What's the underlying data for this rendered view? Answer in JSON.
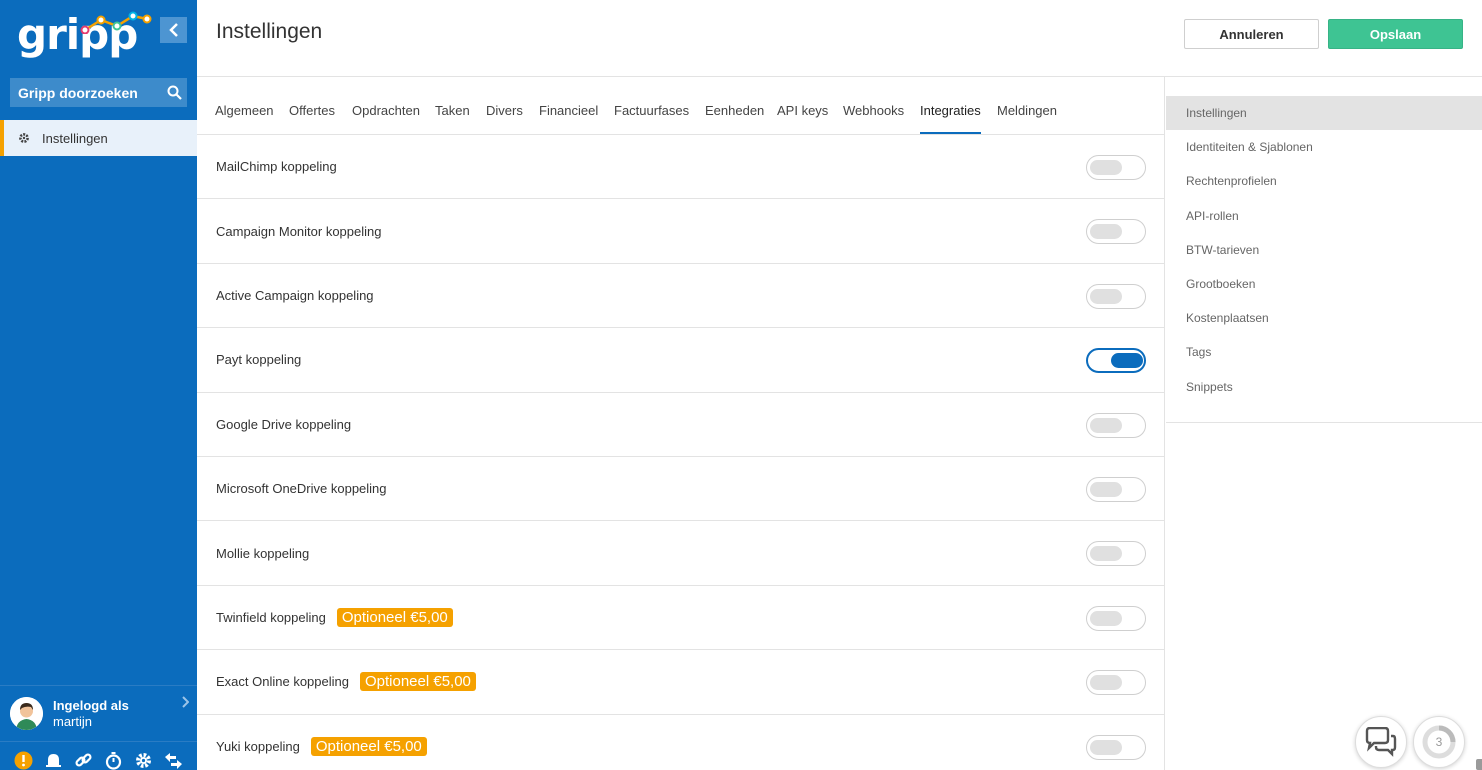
{
  "sidebar": {
    "logo": "gripp",
    "search_label": "Gripp doorzoeken",
    "nav_item": "Instellingen",
    "user_title": "Ingelogd als",
    "user_name": "martijn"
  },
  "header": {
    "title": "Instellingen",
    "cancel_label": "Annuleren",
    "save_label": "Opslaan"
  },
  "tabs": [
    "Algemeen",
    "Offertes",
    "Opdrachten",
    "Taken",
    "Divers",
    "Financieel",
    "Factuurfases",
    "Eenheden",
    "API keys",
    "Webhooks",
    "Integraties",
    "Meldingen"
  ],
  "active_tab": "Integraties",
  "integrations": [
    {
      "label": "MailChimp koppeling",
      "badge": "",
      "enabled": false
    },
    {
      "label": "Campaign Monitor koppeling",
      "badge": "",
      "enabled": false
    },
    {
      "label": "Active Campaign koppeling",
      "badge": "",
      "enabled": false
    },
    {
      "label": "Payt koppeling",
      "badge": "",
      "enabled": true
    },
    {
      "label": "Google Drive koppeling",
      "badge": "",
      "enabled": false
    },
    {
      "label": "Microsoft OneDrive koppeling",
      "badge": "",
      "enabled": false
    },
    {
      "label": "Mollie koppeling",
      "badge": "",
      "enabled": false
    },
    {
      "label": "Twinfield koppeling",
      "badge": "Optioneel €5,00",
      "enabled": false
    },
    {
      "label": "Exact Online koppeling",
      "badge": "Optioneel €5,00",
      "enabled": false
    },
    {
      "label": "Yuki koppeling",
      "badge": "Optioneel €5,00",
      "enabled": false
    }
  ],
  "right_panel": {
    "items": [
      "Instellingen",
      "Identiteiten & Sjablonen",
      "Rechtenprofielen",
      "API-rollen",
      "BTW-tarieven",
      "Grootboeken",
      "Kostenplaatsen",
      "Tags",
      "Snippets"
    ],
    "active": "Instellingen"
  },
  "notifications_count": "3",
  "colors": {
    "sidebar": "#0b6cbd",
    "accent": "#f5a100",
    "save": "#3ec493",
    "tab_active": "#0b6cbd"
  }
}
